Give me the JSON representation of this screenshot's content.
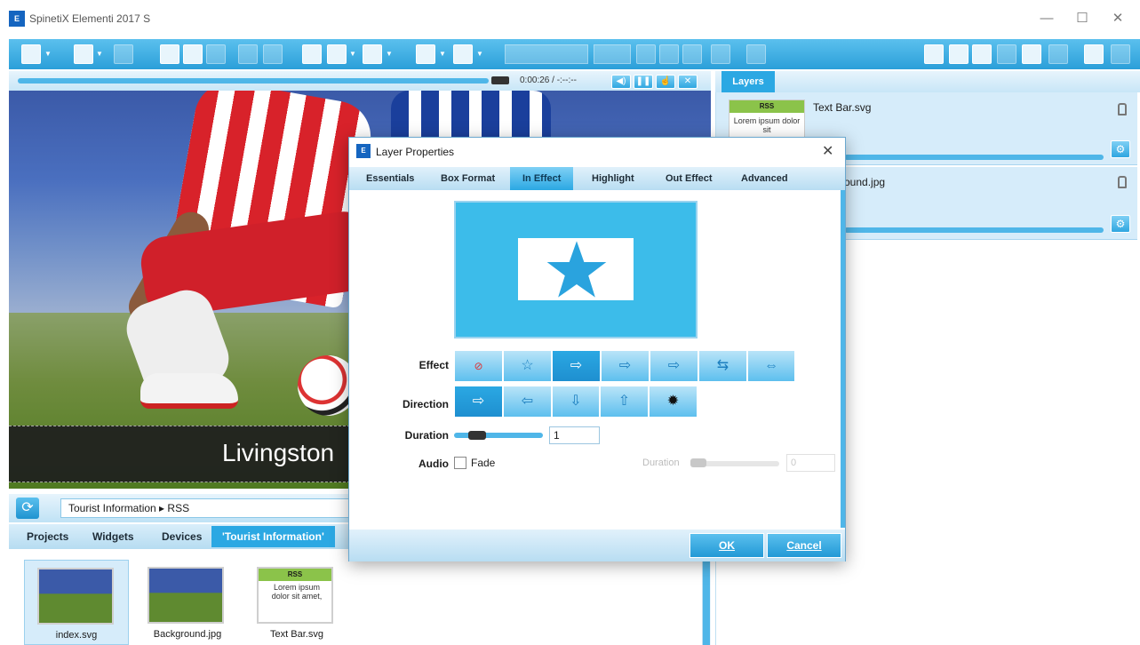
{
  "window": {
    "title": "SpinetiX Elementi 2017 S",
    "icon_text": "E"
  },
  "player": {
    "time": "0:00:26 / -:--:--"
  },
  "preview": {
    "text_bar": "Livingston"
  },
  "library": {
    "path": "Tourist Information  ▸  RSS",
    "tabs": [
      "Projects",
      "Widgets",
      "Devices",
      "'Tourist Information'"
    ],
    "items": [
      {
        "label": "index.svg"
      },
      {
        "label": "Background.jpg"
      },
      {
        "label": "Text Bar.svg"
      }
    ],
    "rss_thumb": {
      "head": "RSS",
      "body": "Lorem ipsum dolor sit amet,"
    }
  },
  "layers": {
    "tab": "Layers",
    "items": [
      {
        "name": "Text Bar.svg"
      },
      {
        "name": "ound.jpg"
      }
    ],
    "rss_thumb": {
      "head": "RSS",
      "body": "Lorem ipsum dolor sit"
    }
  },
  "dialog": {
    "title": "Layer Properties",
    "tabs": [
      "Essentials",
      "Box Format",
      "In Effect",
      "Highlight",
      "Out Effect",
      "Advanced"
    ],
    "active_tab": "In Effect",
    "labels": {
      "effect": "Effect",
      "direction": "Direction",
      "duration": "Duration",
      "audio": "Audio",
      "fade": "Fade",
      "duration2": "Duration"
    },
    "duration_value": "1",
    "duration2_value": "0",
    "ok": "OK",
    "cancel": "Cancel"
  },
  "colors": {
    "accent": "#2ba8e3",
    "toolbar": "#3aaee4",
    "preview_bg": "#3cbcea"
  }
}
